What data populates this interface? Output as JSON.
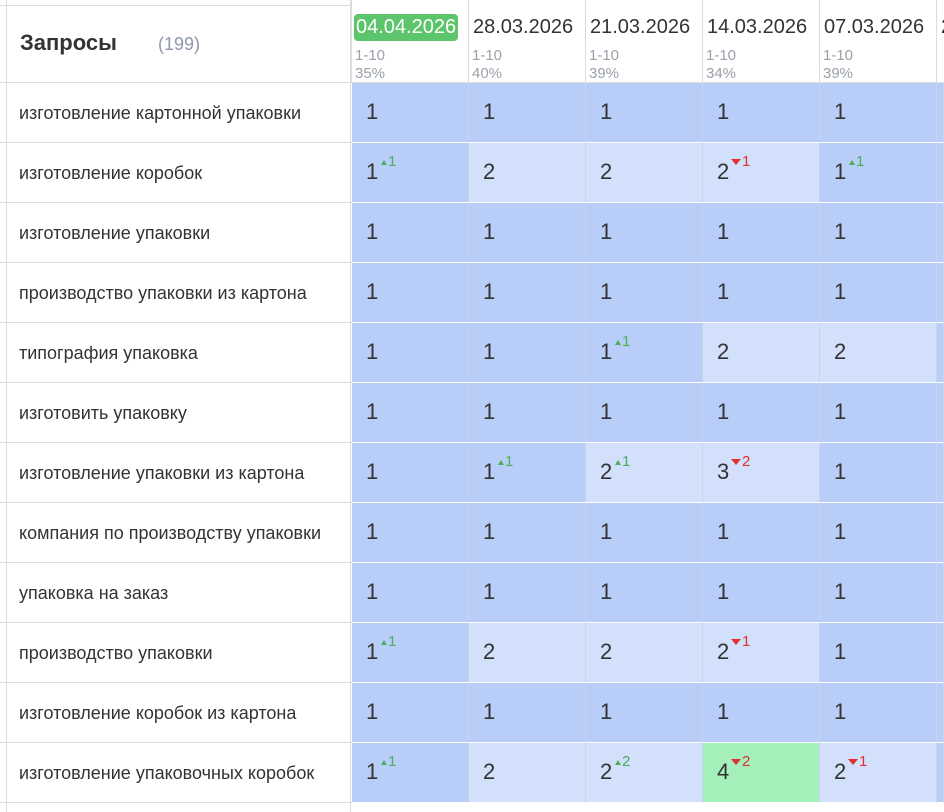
{
  "header": {
    "title": "Запросы",
    "count": "(199)",
    "dates": [
      {
        "date": "04.04.2026",
        "range": "1-10",
        "percent": "35%",
        "current": true
      },
      {
        "date": "28.03.2026",
        "range": "1-10",
        "percent": "40%"
      },
      {
        "date": "21.03.2026",
        "range": "1-10",
        "percent": "39%"
      },
      {
        "date": "14.03.2026",
        "range": "1-10",
        "percent": "34%"
      },
      {
        "date": "07.03.2026",
        "range": "1-10",
        "percent": "39%"
      },
      {
        "date": "2",
        "range": "",
        "percent": ""
      }
    ]
  },
  "rows": [
    {
      "query": "изготовление картонной упаковки",
      "cells": [
        {
          "pos": "1",
          "shade": "dark"
        },
        {
          "pos": "1",
          "shade": "dark"
        },
        {
          "pos": "1",
          "shade": "dark"
        },
        {
          "pos": "1",
          "shade": "dark"
        },
        {
          "pos": "1",
          "shade": "dark"
        }
      ]
    },
    {
      "query": "изготовление коробок",
      "cells": [
        {
          "pos": "1",
          "shade": "dark",
          "delta": "1",
          "dir": "up"
        },
        {
          "pos": "2",
          "shade": "light"
        },
        {
          "pos": "2",
          "shade": "light"
        },
        {
          "pos": "2",
          "shade": "light",
          "delta": "1",
          "dir": "down"
        },
        {
          "pos": "1",
          "shade": "dark",
          "delta": "1",
          "dir": "up"
        }
      ]
    },
    {
      "query": "изготовление упаковки",
      "cells": [
        {
          "pos": "1",
          "shade": "dark"
        },
        {
          "pos": "1",
          "shade": "dark"
        },
        {
          "pos": "1",
          "shade": "dark"
        },
        {
          "pos": "1",
          "shade": "dark"
        },
        {
          "pos": "1",
          "shade": "dark"
        }
      ]
    },
    {
      "query": "производство упаковки из картона",
      "cells": [
        {
          "pos": "1",
          "shade": "dark"
        },
        {
          "pos": "1",
          "shade": "dark"
        },
        {
          "pos": "1",
          "shade": "dark"
        },
        {
          "pos": "1",
          "shade": "dark"
        },
        {
          "pos": "1",
          "shade": "dark"
        }
      ]
    },
    {
      "query": "типография упаковка",
      "cells": [
        {
          "pos": "1",
          "shade": "dark"
        },
        {
          "pos": "1",
          "shade": "dark"
        },
        {
          "pos": "1",
          "shade": "dark",
          "delta": "1",
          "dir": "up"
        },
        {
          "pos": "2",
          "shade": "light"
        },
        {
          "pos": "2",
          "shade": "light"
        }
      ]
    },
    {
      "query": "изготовить упаковку",
      "cells": [
        {
          "pos": "1",
          "shade": "dark"
        },
        {
          "pos": "1",
          "shade": "dark"
        },
        {
          "pos": "1",
          "shade": "dark"
        },
        {
          "pos": "1",
          "shade": "dark"
        },
        {
          "pos": "1",
          "shade": "dark"
        }
      ]
    },
    {
      "query": "изготовление упаковки из картона",
      "cells": [
        {
          "pos": "1",
          "shade": "dark"
        },
        {
          "pos": "1",
          "shade": "dark",
          "delta": "1",
          "dir": "up"
        },
        {
          "pos": "2",
          "shade": "light",
          "delta": "1",
          "dir": "up"
        },
        {
          "pos": "3",
          "shade": "light",
          "delta": "2",
          "dir": "down"
        },
        {
          "pos": "1",
          "shade": "dark"
        }
      ]
    },
    {
      "query": "компания по производству упаковки",
      "cells": [
        {
          "pos": "1",
          "shade": "dark"
        },
        {
          "pos": "1",
          "shade": "dark"
        },
        {
          "pos": "1",
          "shade": "dark"
        },
        {
          "pos": "1",
          "shade": "dark"
        },
        {
          "pos": "1",
          "shade": "dark"
        }
      ]
    },
    {
      "query": "упаковка на заказ",
      "cells": [
        {
          "pos": "1",
          "shade": "dark"
        },
        {
          "pos": "1",
          "shade": "dark"
        },
        {
          "pos": "1",
          "shade": "dark"
        },
        {
          "pos": "1",
          "shade": "dark"
        },
        {
          "pos": "1",
          "shade": "dark"
        }
      ]
    },
    {
      "query": "производство упаковки",
      "cells": [
        {
          "pos": "1",
          "shade": "dark",
          "delta": "1",
          "dir": "up"
        },
        {
          "pos": "2",
          "shade": "light"
        },
        {
          "pos": "2",
          "shade": "light"
        },
        {
          "pos": "2",
          "shade": "light",
          "delta": "1",
          "dir": "down"
        },
        {
          "pos": "1",
          "shade": "dark"
        }
      ]
    },
    {
      "query": "изготовление коробок из картона",
      "cells": [
        {
          "pos": "1",
          "shade": "dark"
        },
        {
          "pos": "1",
          "shade": "dark"
        },
        {
          "pos": "1",
          "shade": "dark"
        },
        {
          "pos": "1",
          "shade": "dark"
        },
        {
          "pos": "1",
          "shade": "dark"
        }
      ]
    },
    {
      "query": "изготовление упаковочных коробок",
      "cells": [
        {
          "pos": "1",
          "shade": "dark",
          "delta": "1",
          "dir": "up"
        },
        {
          "pos": "2",
          "shade": "light"
        },
        {
          "pos": "2",
          "shade": "light",
          "delta": "2",
          "dir": "up"
        },
        {
          "pos": "4",
          "shade": "green",
          "delta": "2",
          "dir": "down"
        },
        {
          "pos": "2",
          "shade": "light",
          "delta": "1",
          "dir": "down"
        }
      ]
    }
  ]
}
